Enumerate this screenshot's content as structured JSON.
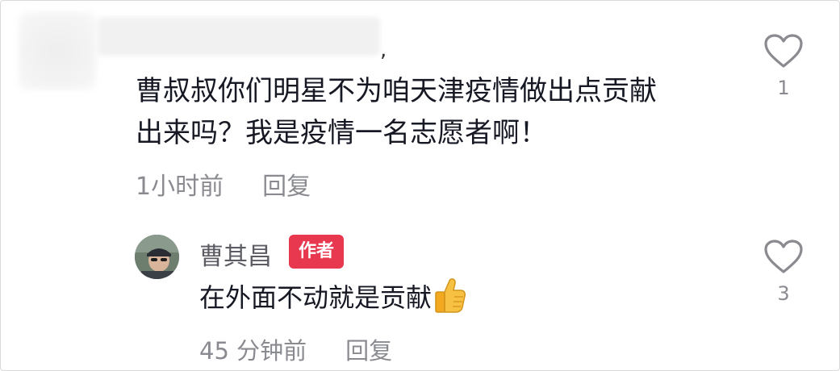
{
  "comment": {
    "username_suffix": ",",
    "text_line1": "曹叔叔你们明星不为咱天津疫情做出点贡献",
    "text_line2": "出来吗？我是疫情一名志愿者啊！",
    "time": "1小时前",
    "reply_label": "回复",
    "like_count": "1"
  },
  "reply": {
    "author_name": "曹其昌",
    "author_badge": "作者",
    "text": "在外面不动就是贡献",
    "emoji_icon": "thumbs-up-icon",
    "time": "45 分钟前",
    "reply_label": "回复",
    "like_count": "3"
  },
  "colors": {
    "badge": "#e8384f",
    "meta_text": "#8a8b91",
    "main_text": "#161823"
  }
}
